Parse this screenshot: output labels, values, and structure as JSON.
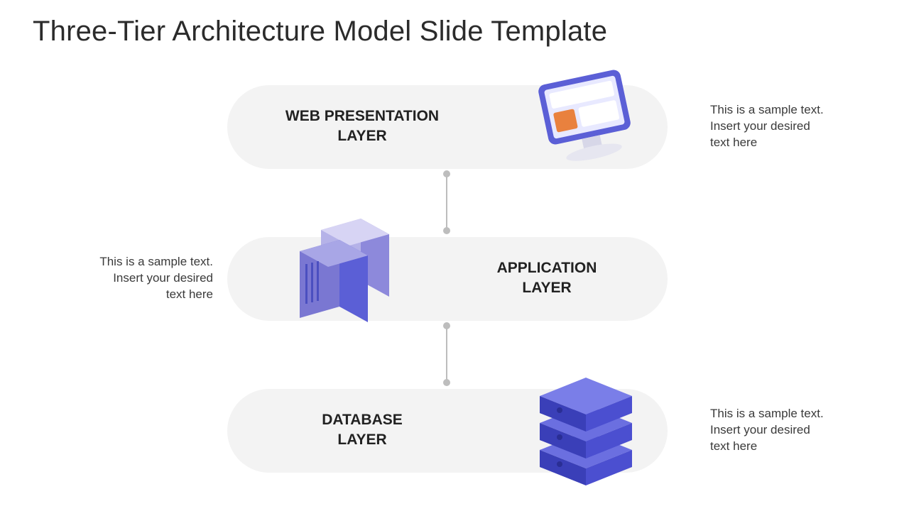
{
  "title": "Three-Tier Architecture Model Slide Template",
  "tiers": [
    {
      "label_line1": "WEB PRESENTATION",
      "label_line2": "LAYER",
      "desc_line1": "This is a sample text.",
      "desc_line2": "Insert your desired",
      "desc_line3": "text here",
      "icon": "monitor-icon"
    },
    {
      "label_line1": "APPLICATION",
      "label_line2": "LAYER",
      "desc_line1": "This is a sample text.",
      "desc_line2": "Insert your desired",
      "desc_line3": "text here",
      "icon": "server-icon"
    },
    {
      "label_line1": "DATABASE",
      "label_line2": "LAYER",
      "desc_line1": "This is a sample text.",
      "desc_line2": "Insert your desired",
      "desc_line3": "text here",
      "icon": "database-icon"
    }
  ],
  "colors": {
    "accent": "#5b5fd6",
    "accent_light": "#a8a6e6",
    "accent_dark": "#3a3fb8",
    "pill": "#f3f3f3"
  }
}
